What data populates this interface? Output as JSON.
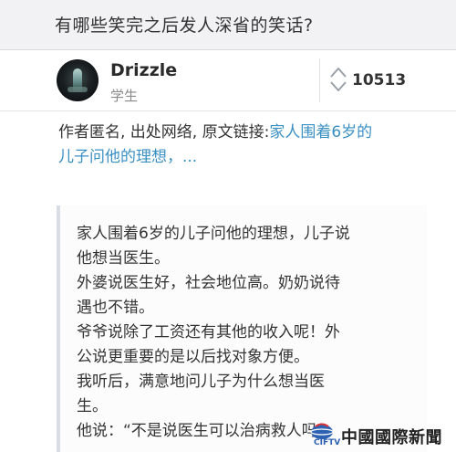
{
  "question": {
    "title": "有哪些笑完之后发人深省的笑话?"
  },
  "author": {
    "name": "Drizzle",
    "tag": "学生"
  },
  "votes": {
    "count": "10513"
  },
  "answer": {
    "intro_prefix": "作者匿名, 出处网络, 原文链接:",
    "intro_link_line1": "家人围着6岁的",
    "intro_link_line2": "儿子问他的理想，...",
    "quote_lines": [
      "家人围着6岁的儿子问他的理想，儿子说",
      "他想当医生。",
      "外婆说医生好，社会地位高。奶奶说待",
      "遇也不错。",
      "爷爷说除了工资还有其他的收入呢！外",
      "公说更重要的是以后找对象方便。",
      "我听后，满意地问儿子为什么想当医",
      "生。",
      "他说：“不是说医生可以治病救人吗？"
    ]
  },
  "watermark": {
    "logo_text": "CIFTV",
    "text": "中國國際新聞臺"
  },
  "colors": {
    "link": "#3a8fc3",
    "header_bg": "#f2f2f4",
    "quote_border": "#d9dde6"
  }
}
